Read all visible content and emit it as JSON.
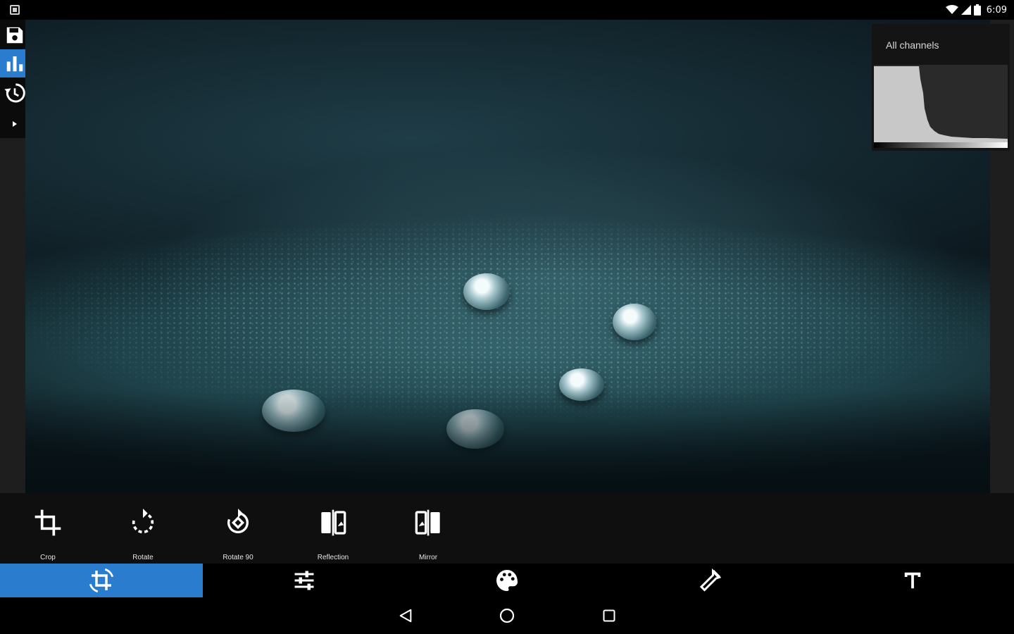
{
  "status_bar": {
    "time": "6:09",
    "icons": [
      "notification-icon",
      "wifi-icon",
      "cell-signal-icon",
      "battery-icon"
    ]
  },
  "left_toolbar": {
    "items": [
      {
        "name": "save-icon",
        "active": false
      },
      {
        "name": "histogram-icon",
        "active": true
      },
      {
        "name": "history-icon",
        "active": false
      },
      {
        "name": "expand-arrow-icon",
        "active": false
      }
    ]
  },
  "histogram": {
    "title": "All channels"
  },
  "tools": [
    {
      "label": "Crop",
      "icon": "crop-icon"
    },
    {
      "label": "Rotate",
      "icon": "rotate-icon"
    },
    {
      "label": "Rotate 90",
      "icon": "rotate-90-icon"
    },
    {
      "label": "Reflection",
      "icon": "reflection-icon"
    },
    {
      "label": "Mirror",
      "icon": "mirror-icon"
    }
  ],
  "categories": [
    {
      "icon": "transform-icon",
      "active": true
    },
    {
      "icon": "adjust-sliders-icon",
      "active": false
    },
    {
      "icon": "palette-icon",
      "active": false
    },
    {
      "icon": "eyedropper-icon",
      "active": false
    },
    {
      "icon": "text-icon",
      "active": false
    }
  ],
  "colors": {
    "accent": "#2a7ccf",
    "tray": "#0f0f0f",
    "background": "#000000"
  },
  "nav": [
    "back-icon",
    "home-icon",
    "recents-icon"
  ]
}
